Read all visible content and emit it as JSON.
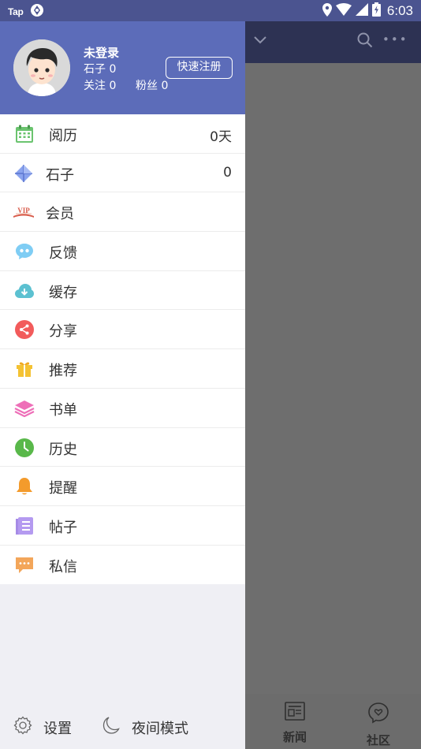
{
  "status_bar": {
    "left_app": "Tap",
    "time": "6:03"
  },
  "profile": {
    "name": "未登录",
    "stones": "石子 0",
    "following": "关注 0",
    "fans": "粉丝 0",
    "register_button": "快速注册"
  },
  "menu": [
    {
      "label": "阅历",
      "value": "0天",
      "icon": "calendar-icon",
      "color": "#6bc46f"
    },
    {
      "label": "石子",
      "value": "0",
      "icon": "diamond-icon",
      "color": "#7a95e8"
    },
    {
      "label": "会员",
      "value": "",
      "icon": "vip-icon",
      "color": "#d85b4a"
    },
    {
      "label": "反馈",
      "value": "",
      "icon": "chat-bubble-icon",
      "color": "#6cc4f0"
    },
    {
      "label": "缓存",
      "value": "",
      "icon": "cloud-download-icon",
      "color": "#5cc1d1"
    },
    {
      "label": "分享",
      "value": "",
      "icon": "share-icon",
      "color": "#f25b5b"
    },
    {
      "label": "推荐",
      "value": "",
      "icon": "gift-icon",
      "color": "#f4c233"
    },
    {
      "label": "书单",
      "value": "",
      "icon": "layers-icon",
      "color": "#ee6fb8"
    },
    {
      "label": "历史",
      "value": "",
      "icon": "clock-icon",
      "color": "#59b84a"
    },
    {
      "label": "提醒",
      "value": "",
      "icon": "bell-icon",
      "color": "#f39b2c"
    },
    {
      "label": "帖子",
      "value": "",
      "icon": "posts-icon",
      "color": "#a68be6"
    },
    {
      "label": "私信",
      "value": "",
      "icon": "message-icon",
      "color": "#f3a65a"
    }
  ],
  "footer": {
    "settings": "设置",
    "night_mode": "夜间模式"
  },
  "background_app": {
    "tabs": [
      {
        "label": "新闻"
      },
      {
        "label": "社区"
      }
    ]
  }
}
